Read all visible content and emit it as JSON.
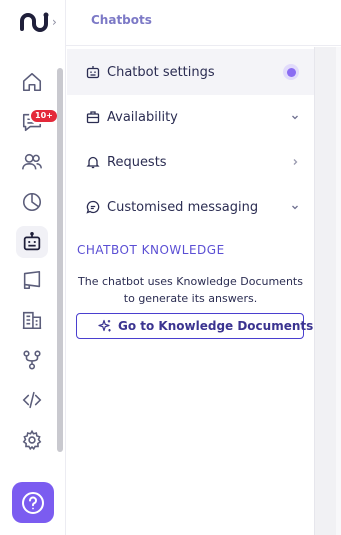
{
  "header": {
    "title": "Chatbots"
  },
  "rail": {
    "badge_count": "10+",
    "items": [
      {
        "icon": "home-icon"
      },
      {
        "icon": "chat-icon"
      },
      {
        "icon": "contacts-icon"
      },
      {
        "icon": "analytics-pie-icon"
      },
      {
        "icon": "chatbot-icon",
        "active": true
      },
      {
        "icon": "megaphone-icon"
      },
      {
        "icon": "building-icon"
      },
      {
        "icon": "flow-icon"
      },
      {
        "icon": "code-icon"
      },
      {
        "icon": "gear-icon"
      }
    ],
    "help_icon": "help-icon"
  },
  "menu": {
    "items": [
      {
        "label": "Chatbot settings",
        "icon": "robot-icon",
        "active": true
      },
      {
        "label": "Availability",
        "icon": "briefcase-icon",
        "chevron": "down"
      },
      {
        "label": "Requests",
        "icon": "bell-icon",
        "chevron": "right"
      },
      {
        "label": "Customised messaging",
        "icon": "message-icon",
        "chevron": "down"
      }
    ]
  },
  "knowledge": {
    "title": "CHATBOT KNOWLEDGE",
    "description": "The chatbot uses Knowledge Documents to generate its answers.",
    "button_label": "Go to Knowledge Documents"
  },
  "colors": {
    "accent": "#7b5cf0",
    "accent_dark": "#4a3fcf",
    "badge": "#e4293a",
    "title": "#7c79c6"
  }
}
